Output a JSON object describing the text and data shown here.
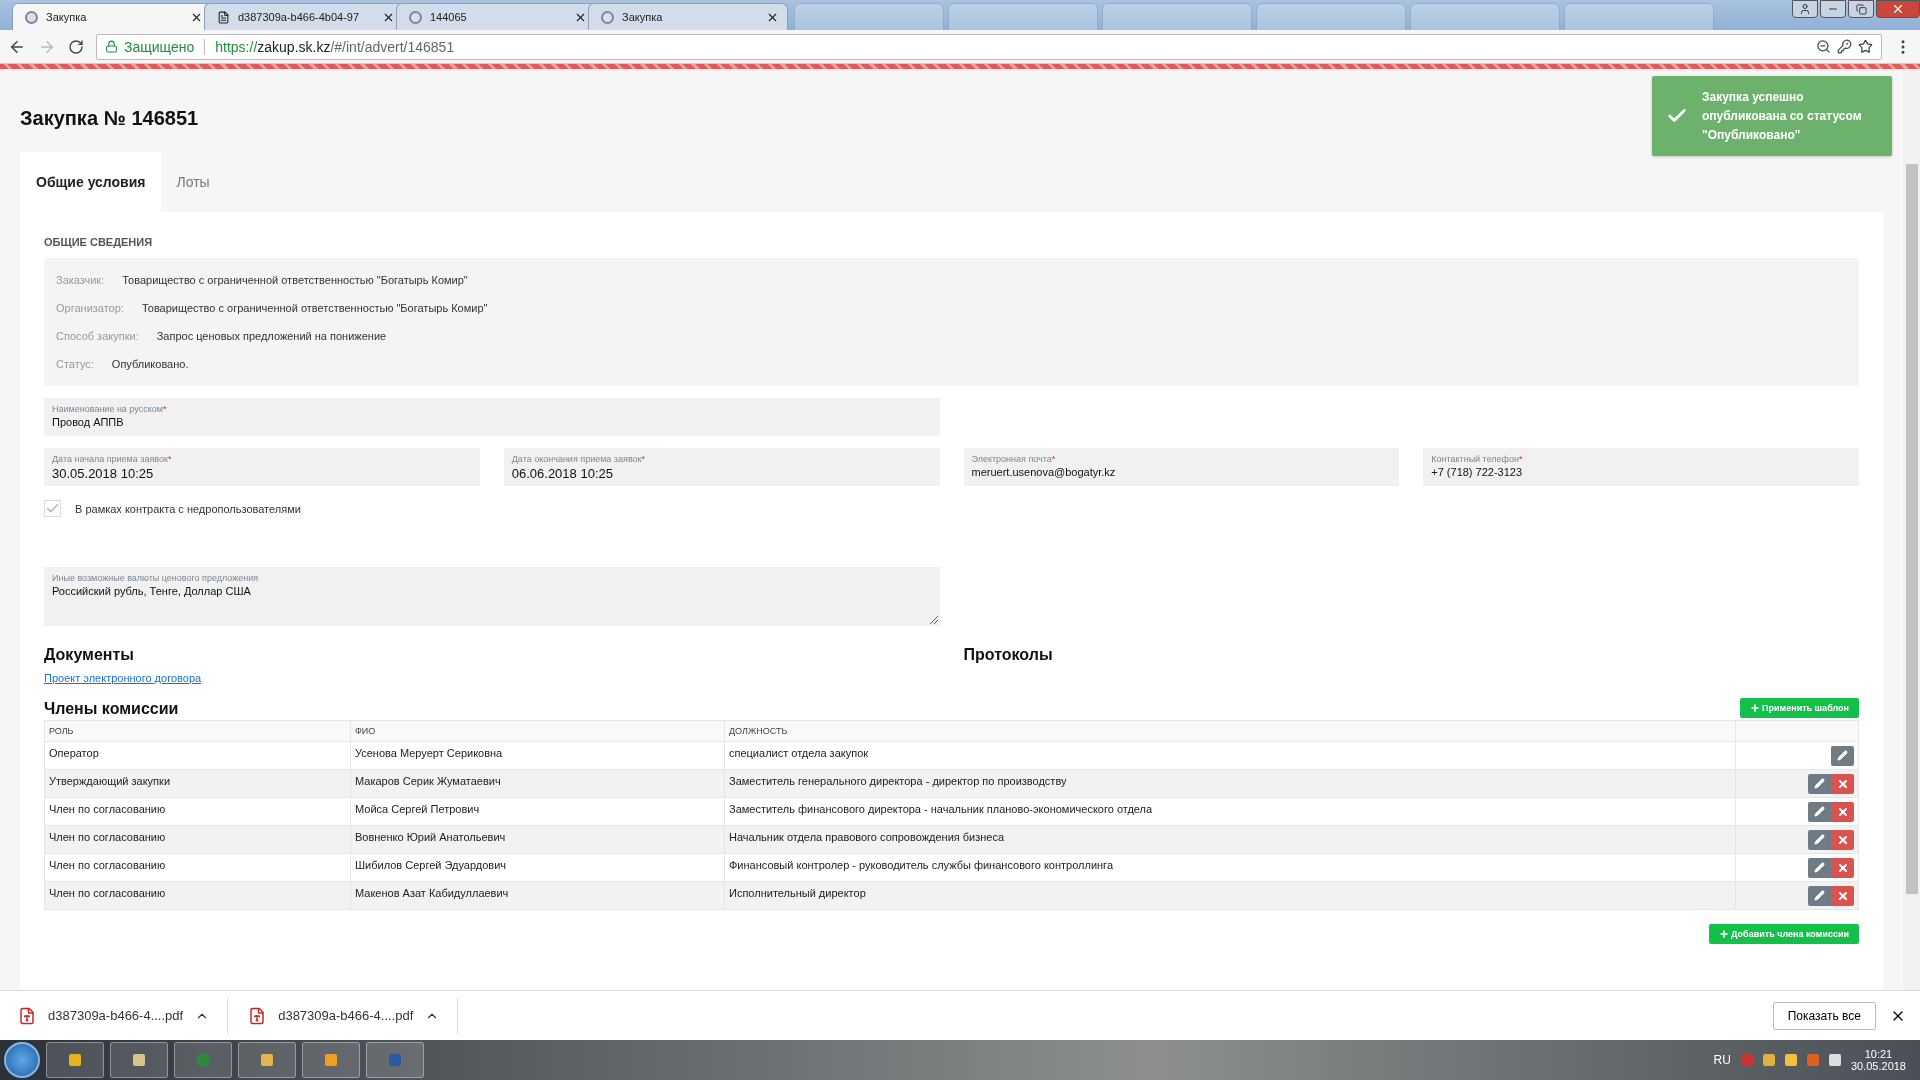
{
  "browser": {
    "tabs": [
      {
        "title": "Закупка",
        "kind": "site",
        "selected": true
      },
      {
        "title": "d387309a-b466-4b04-97",
        "kind": "document",
        "selected": false
      },
      {
        "title": "144065",
        "kind": "site",
        "selected": false
      },
      {
        "title": "Закупка",
        "kind": "site",
        "selected": false
      }
    ],
    "address": {
      "secure_label": "Защищено",
      "scheme": "https://",
      "host": "zakup.sk.kz",
      "path": "/#/int/advert/146851"
    }
  },
  "page": {
    "title": "Закупка № 146851",
    "tabs": [
      {
        "label": "Общие условия",
        "selected": true
      },
      {
        "label": "Лоты",
        "selected": false
      }
    ],
    "section_heading": "ОБЩИЕ СВЕДЕНИЯ",
    "info": [
      {
        "label": "Заказчик:",
        "value": "Товарищество с ограниченной ответственностью \"Богатырь Комир\""
      },
      {
        "label": "Организатор:",
        "value": "Товарищество с ограниченной ответственностью \"Богатырь Комир\""
      },
      {
        "label": "Способ закупки:",
        "value": "Запрос ценовых предложений на понижение"
      },
      {
        "label": "Статус:",
        "value": "Опубликовано."
      }
    ],
    "name_field": {
      "label": "Наименование на русском",
      "required_mark": "*",
      "value": "Провод АППВ"
    },
    "date_fields": [
      {
        "label": "Дата начала приема заявок",
        "required_mark": "*",
        "value": "30.05.2018 10:25"
      },
      {
        "label": "Дата окончания приема заявок",
        "required_mark": "*",
        "value": "06.06.2018 10:25"
      },
      {
        "label": "Электронная почта",
        "required_mark": "*",
        "value": "meruert.usenova@bogatyr.kz"
      },
      {
        "label": "Контактный телефон",
        "required_mark": "*",
        "value": "+7 (718) 722-3123"
      }
    ],
    "checkbox": {
      "label": "В рамках контракта с недропользователями",
      "checked": true,
      "disabled": true
    },
    "currency_field": {
      "label": "Иные возможные валюты ценового предложения",
      "value": "Российский  рубль, Тенге, Доллар США"
    },
    "documents": {
      "heading": "Документы",
      "links": [
        "Проект электронного договора"
      ]
    },
    "protocols": {
      "heading": "Протоколы"
    },
    "commission": {
      "heading": "Члены комиссии",
      "apply_button": "Применить шаблон",
      "columns": [
        "РОЛЬ",
        "ФИО",
        "ДОЛЖНОСТЬ"
      ],
      "rows": [
        {
          "role": "Оператор",
          "name": "Усенова Меруерт Сериковна",
          "position": "специалист отдела закупок",
          "deletable": false
        },
        {
          "role": "Утверждающий закупки",
          "name": "Макаров Серик Жуматаевич",
          "position": "Заместитель генерального директора - директор по производству",
          "deletable": true
        },
        {
          "role": "Член по согласованию",
          "name": "Мойса Сергей Петрович",
          "position": "Заместитель финансового директора - начальник планово-экономического отдела",
          "deletable": true
        },
        {
          "role": "Член по согласованию",
          "name": "Вовненко Юрий Анатольевич",
          "position": "Начальник отдела правового сопровождения бизнеса",
          "deletable": true
        },
        {
          "role": "Член по согласованию",
          "name": "Шибилов Сергей Эдуардович",
          "position": "Финансовый контролер - руководитель службы финансового контроллинга",
          "deletable": true
        },
        {
          "role": "Член по согласованию",
          "name": "Макенов Азат Кабидуллаевич",
          "position": "Исполнительный директор",
          "deletable": true
        }
      ],
      "add_button": "Добавить члена комиссии"
    },
    "toast": {
      "text": "Закупка успешно опубликована со статусом \"Опубликовано\""
    }
  },
  "downloads": {
    "items": [
      {
        "name": "d387309a-b466-4....pdf"
      },
      {
        "name": "d387309a-b466-4....pdf"
      }
    ],
    "show_all": "Показать все"
  },
  "taskbar": {
    "language": "RU",
    "time": "10:21",
    "date": "30.05.2018"
  }
}
